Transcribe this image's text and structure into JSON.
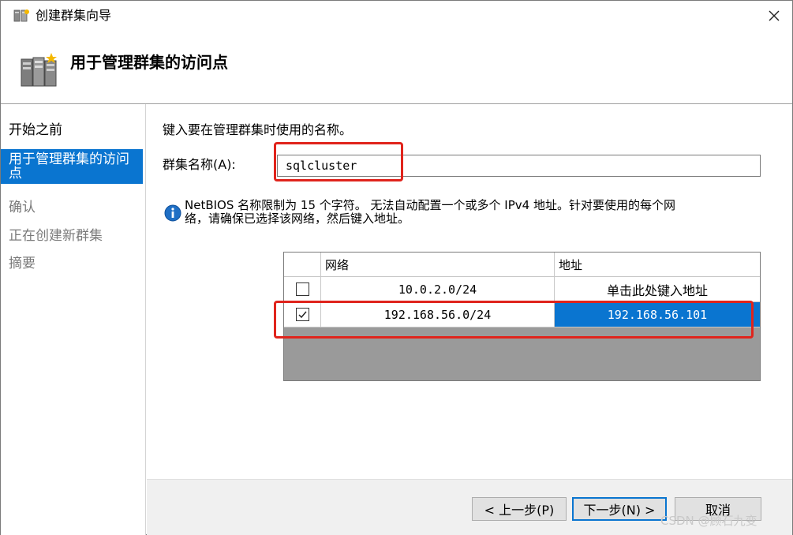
{
  "window": {
    "title": "创建群集向导",
    "close_symbol": "✕"
  },
  "header": {
    "title": "用于管理群集的访问点",
    "icon": "cluster-servers-icon"
  },
  "sidebar": {
    "items": [
      {
        "label": "开始之前",
        "state": "done"
      },
      {
        "label": "用于管理群集的访问点",
        "state": "active"
      },
      {
        "label": "确认",
        "state": "pending"
      },
      {
        "label": "正在创建新群集",
        "state": "pending"
      },
      {
        "label": "摘要",
        "state": "pending"
      }
    ]
  },
  "main": {
    "instruction": "键入要在管理群集时使用的名称。",
    "name_label": "群集名称(A):",
    "name_value": "sqlcluster",
    "info_line1": "NetBIOS 名称限制为 15 个字符。 无法自动配置一个或多个 IPv4 地址。针对要使用的每个网",
    "info_line2": "络，请确保已选择该网络，然后键入地址。"
  },
  "network_grid": {
    "headers": [
      "",
      "网络",
      "地址"
    ],
    "rows": [
      {
        "checked": false,
        "network": "10.0.2.0/24",
        "address": "单击此处键入地址"
      },
      {
        "checked": true,
        "network": "192.168.56.0/24",
        "address": "192.168.56.101"
      }
    ]
  },
  "footer": {
    "back_label": "< 上一步(P)",
    "next_label": "下一步(N) >",
    "cancel_label": "取消"
  },
  "watermark": "CSDN @顾石九变",
  "colors": {
    "accent": "#0a75d0",
    "highlight": "#e0241c",
    "grid_background": "#9a9a9a"
  }
}
